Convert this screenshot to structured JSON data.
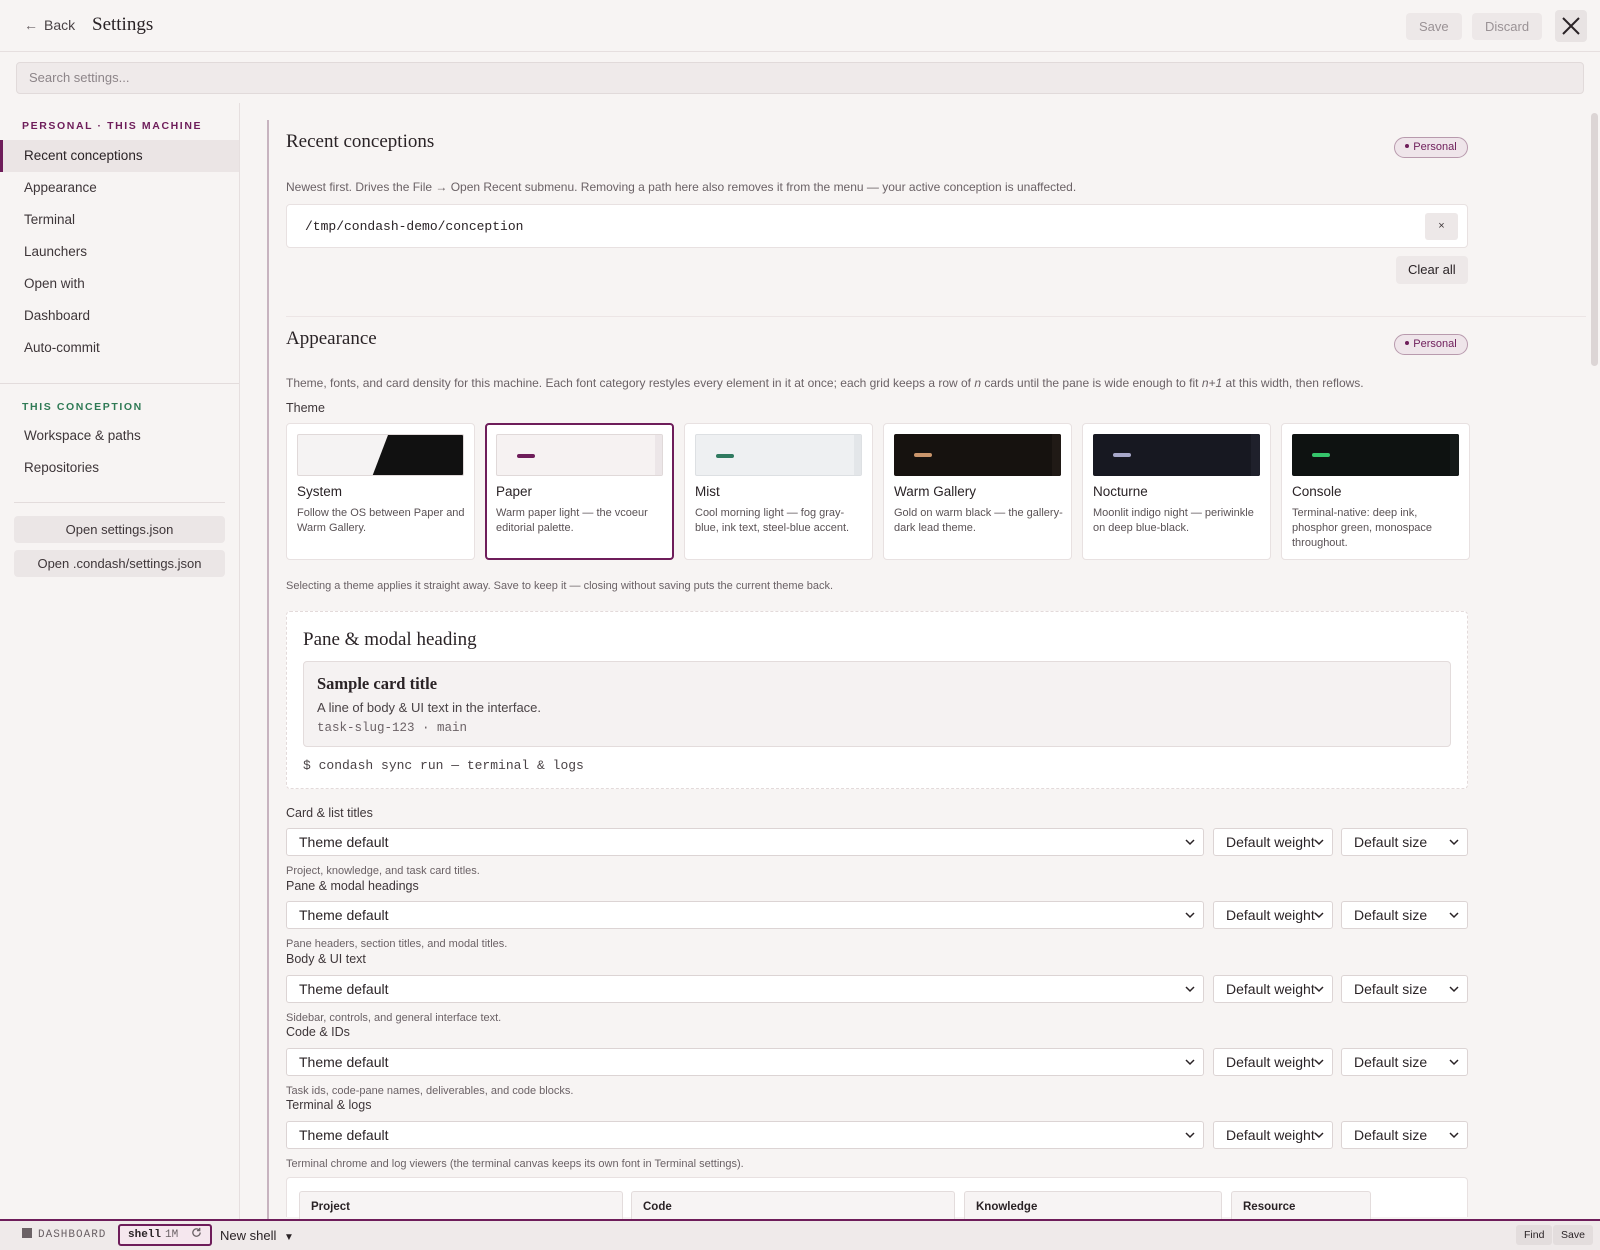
{
  "header": {
    "back_label": "Back",
    "back_arrow": "←",
    "title": "Settings",
    "save_label": "Save",
    "discard_label": "Discard"
  },
  "search": {
    "placeholder": "Search settings..."
  },
  "sidebar": {
    "personal_heading": "PERSONAL · THIS MACHINE",
    "personal_items": [
      {
        "label": "Recent conceptions",
        "active": true
      },
      {
        "label": "Appearance"
      },
      {
        "label": "Terminal"
      },
      {
        "label": "Launchers"
      },
      {
        "label": "Open with"
      },
      {
        "label": "Dashboard"
      },
      {
        "label": "Auto-commit"
      }
    ],
    "conception_heading": "THIS CONCEPTION",
    "conception_items": [
      {
        "label": "Workspace & paths"
      },
      {
        "label": "Repositories"
      }
    ],
    "buttons": [
      "Open settings.json",
      "Open .condash/settings.json"
    ]
  },
  "recent": {
    "title": "Recent conceptions",
    "badge": "Personal",
    "description": "Newest first. Drives the File → Open Recent submenu. Removing a path here also removes it from the menu — your active conception is unaffected.",
    "paths": [
      "/tmp/condash-demo/conception"
    ],
    "remove_label": "×",
    "clear_all_label": "Clear all"
  },
  "appearance": {
    "title": "Appearance",
    "badge": "Personal",
    "description_a": "Theme, fonts, and card density for this machine. Each font category restyles every element in it at once; each grid keeps a row of ",
    "description_n": "n",
    "description_b": " cards until the pane is wide enough to fit ",
    "description_n1": "n+1",
    "description_c": " at this width, then reflows.",
    "theme_label": "Theme",
    "themes": [
      {
        "name": "System",
        "desc": "Follow the OS between Paper and Warm Gallery.",
        "bg": "#f5f3f3",
        "accent": "",
        "selected": false
      },
      {
        "name": "Paper",
        "desc": "Warm paper light — the vcoeur editorial palette.",
        "bg": "#f6f2f2",
        "accent": "#6e1d5a",
        "selected": true
      },
      {
        "name": "Mist",
        "desc": "Cool morning light — fog gray-blue, ink text, steel-blue accent.",
        "bg": "#eef0f2",
        "accent": "#2f7a60",
        "selected": false
      },
      {
        "name": "Warm Gallery",
        "desc": "Gold on warm black — the gallery-dark lead theme.",
        "bg": "#16120f",
        "accent": "#c9956b",
        "selected": false
      },
      {
        "name": "Nocturne",
        "desc": "Moonlit indigo night — periwinkle on deep blue-black.",
        "bg": "#171821",
        "accent": "#a7a7c9",
        "selected": false
      },
      {
        "name": "Console",
        "desc": "Terminal-native: deep ink, phosphor green, monospace throughout.",
        "bg": "#0e1211",
        "accent": "#35c46b",
        "selected": false
      }
    ],
    "theme_note": "Selecting a theme applies it straight away. Save to keep it — closing without saving puts the current theme back.",
    "preview": {
      "heading": "Pane & modal heading",
      "card_title": "Sample card title",
      "body_text": "A line of body & UI text in the interface.",
      "code_text": "task-slug-123 · main",
      "terminal_text": "$ condash sync run — terminal & logs"
    },
    "font_rows": [
      {
        "label": "Card & list titles",
        "font": "Theme default",
        "weight": "Default weight",
        "size": "Default size",
        "hint": "Project, knowledge, and task card titles."
      },
      {
        "label": "Pane & modal headings",
        "font": "Theme default",
        "weight": "Default weight",
        "size": "Default size",
        "hint": "Pane headers, section titles, and modal titles."
      },
      {
        "label": "Body & UI text",
        "font": "Theme default",
        "weight": "Default weight",
        "size": "Default size",
        "hint": "Sidebar, controls, and general interface text."
      },
      {
        "label": "Code & IDs",
        "font": "Theme default",
        "weight": "Default weight",
        "size": "Default size",
        "hint": "Task ids, code-pane names, deliverables, and code blocks."
      },
      {
        "label": "Terminal & logs",
        "font": "Theme default",
        "weight": "Default weight",
        "size": "Default size",
        "hint": "Terminal chrome and log viewers (the terminal canvas keeps its own font in Terminal settings)."
      }
    ],
    "grid_headers": [
      "Project",
      "Code",
      "Knowledge",
      "Resource"
    ]
  },
  "statusbar": {
    "dashboard_label": "DASHBOARD",
    "shell_name": "shell",
    "shell_age": "1M",
    "new_shell_label": "New shell",
    "new_shell_caret": "▼",
    "find_label": "Find",
    "save_label": "Save"
  },
  "colors": {
    "accent": "#6e1d5a",
    "conception_accent": "#2f7a55",
    "background": "#f7f4f3"
  }
}
